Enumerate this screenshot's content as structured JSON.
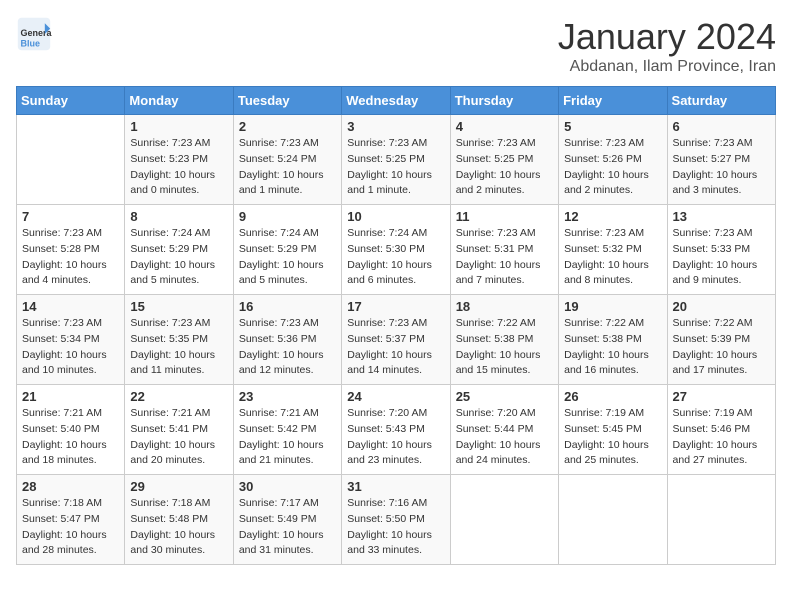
{
  "header": {
    "logo_line1": "General",
    "logo_line2": "Blue",
    "month": "January 2024",
    "location": "Abdanan, Ilam Province, Iran"
  },
  "days_of_week": [
    "Sunday",
    "Monday",
    "Tuesday",
    "Wednesday",
    "Thursday",
    "Friday",
    "Saturday"
  ],
  "weeks": [
    [
      {
        "day": "",
        "sunrise": "",
        "sunset": "",
        "daylight": ""
      },
      {
        "day": "1",
        "sunrise": "7:23 AM",
        "sunset": "5:23 PM",
        "daylight": "10 hours and 0 minutes."
      },
      {
        "day": "2",
        "sunrise": "7:23 AM",
        "sunset": "5:24 PM",
        "daylight": "10 hours and 1 minute."
      },
      {
        "day": "3",
        "sunrise": "7:23 AM",
        "sunset": "5:25 PM",
        "daylight": "10 hours and 1 minute."
      },
      {
        "day": "4",
        "sunrise": "7:23 AM",
        "sunset": "5:25 PM",
        "daylight": "10 hours and 2 minutes."
      },
      {
        "day": "5",
        "sunrise": "7:23 AM",
        "sunset": "5:26 PM",
        "daylight": "10 hours and 2 minutes."
      },
      {
        "day": "6",
        "sunrise": "7:23 AM",
        "sunset": "5:27 PM",
        "daylight": "10 hours and 3 minutes."
      }
    ],
    [
      {
        "day": "7",
        "sunrise": "7:23 AM",
        "sunset": "5:28 PM",
        "daylight": "10 hours and 4 minutes."
      },
      {
        "day": "8",
        "sunrise": "7:24 AM",
        "sunset": "5:29 PM",
        "daylight": "10 hours and 5 minutes."
      },
      {
        "day": "9",
        "sunrise": "7:24 AM",
        "sunset": "5:29 PM",
        "daylight": "10 hours and 5 minutes."
      },
      {
        "day": "10",
        "sunrise": "7:24 AM",
        "sunset": "5:30 PM",
        "daylight": "10 hours and 6 minutes."
      },
      {
        "day": "11",
        "sunrise": "7:23 AM",
        "sunset": "5:31 PM",
        "daylight": "10 hours and 7 minutes."
      },
      {
        "day": "12",
        "sunrise": "7:23 AM",
        "sunset": "5:32 PM",
        "daylight": "10 hours and 8 minutes."
      },
      {
        "day": "13",
        "sunrise": "7:23 AM",
        "sunset": "5:33 PM",
        "daylight": "10 hours and 9 minutes."
      }
    ],
    [
      {
        "day": "14",
        "sunrise": "7:23 AM",
        "sunset": "5:34 PM",
        "daylight": "10 hours and 10 minutes."
      },
      {
        "day": "15",
        "sunrise": "7:23 AM",
        "sunset": "5:35 PM",
        "daylight": "10 hours and 11 minutes."
      },
      {
        "day": "16",
        "sunrise": "7:23 AM",
        "sunset": "5:36 PM",
        "daylight": "10 hours and 12 minutes."
      },
      {
        "day": "17",
        "sunrise": "7:23 AM",
        "sunset": "5:37 PM",
        "daylight": "10 hours and 14 minutes."
      },
      {
        "day": "18",
        "sunrise": "7:22 AM",
        "sunset": "5:38 PM",
        "daylight": "10 hours and 15 minutes."
      },
      {
        "day": "19",
        "sunrise": "7:22 AM",
        "sunset": "5:38 PM",
        "daylight": "10 hours and 16 minutes."
      },
      {
        "day": "20",
        "sunrise": "7:22 AM",
        "sunset": "5:39 PM",
        "daylight": "10 hours and 17 minutes."
      }
    ],
    [
      {
        "day": "21",
        "sunrise": "7:21 AM",
        "sunset": "5:40 PM",
        "daylight": "10 hours and 18 minutes."
      },
      {
        "day": "22",
        "sunrise": "7:21 AM",
        "sunset": "5:41 PM",
        "daylight": "10 hours and 20 minutes."
      },
      {
        "day": "23",
        "sunrise": "7:21 AM",
        "sunset": "5:42 PM",
        "daylight": "10 hours and 21 minutes."
      },
      {
        "day": "24",
        "sunrise": "7:20 AM",
        "sunset": "5:43 PM",
        "daylight": "10 hours and 23 minutes."
      },
      {
        "day": "25",
        "sunrise": "7:20 AM",
        "sunset": "5:44 PM",
        "daylight": "10 hours and 24 minutes."
      },
      {
        "day": "26",
        "sunrise": "7:19 AM",
        "sunset": "5:45 PM",
        "daylight": "10 hours and 25 minutes."
      },
      {
        "day": "27",
        "sunrise": "7:19 AM",
        "sunset": "5:46 PM",
        "daylight": "10 hours and 27 minutes."
      }
    ],
    [
      {
        "day": "28",
        "sunrise": "7:18 AM",
        "sunset": "5:47 PM",
        "daylight": "10 hours and 28 minutes."
      },
      {
        "day": "29",
        "sunrise": "7:18 AM",
        "sunset": "5:48 PM",
        "daylight": "10 hours and 30 minutes."
      },
      {
        "day": "30",
        "sunrise": "7:17 AM",
        "sunset": "5:49 PM",
        "daylight": "10 hours and 31 minutes."
      },
      {
        "day": "31",
        "sunrise": "7:16 AM",
        "sunset": "5:50 PM",
        "daylight": "10 hours and 33 minutes."
      },
      {
        "day": "",
        "sunrise": "",
        "sunset": "",
        "daylight": ""
      },
      {
        "day": "",
        "sunrise": "",
        "sunset": "",
        "daylight": ""
      },
      {
        "day": "",
        "sunrise": "",
        "sunset": "",
        "daylight": ""
      }
    ]
  ]
}
